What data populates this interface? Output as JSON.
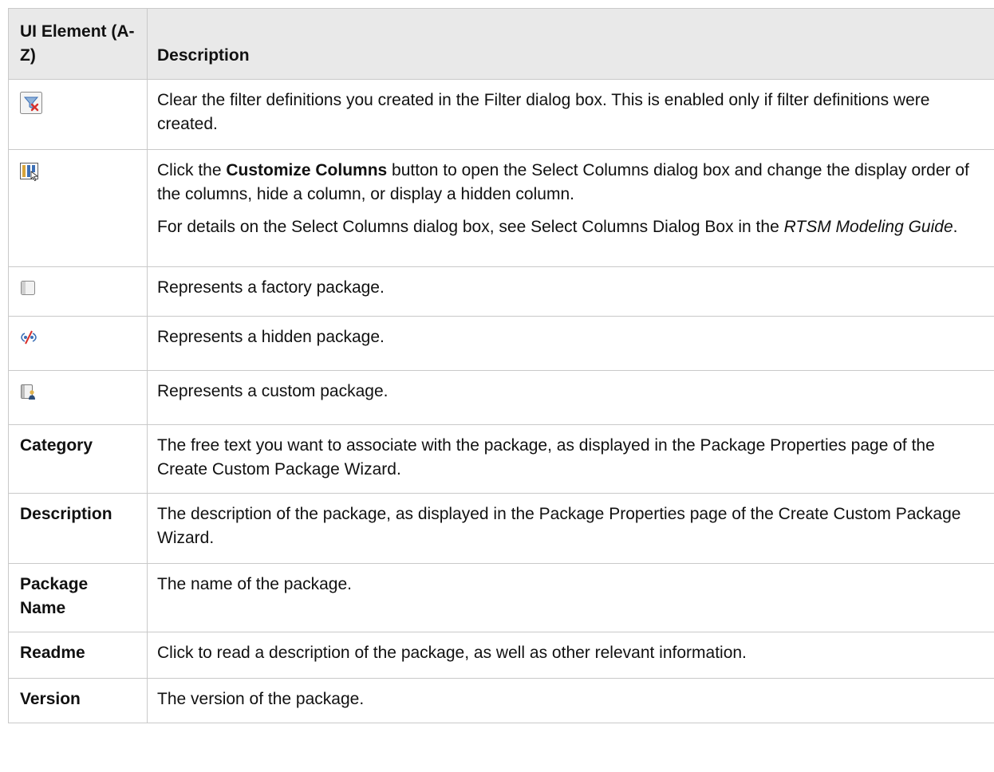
{
  "header": {
    "col1": "UI Element (A-Z)",
    "col2": "Description"
  },
  "rows": [
    {
      "icon": "clear-filter-icon",
      "desc": "Clear the filter definitions you created in the Filter dialog box. This is enabled only if filter definitions were created."
    },
    {
      "icon": "customize-columns-icon",
      "desc_p1_pre": "Click the ",
      "desc_p1_bold": "Customize Columns",
      "desc_p1_post": " button to open the Select Columns dialog box and change the display order of the columns, hide a column, or display a hidden column.",
      "desc_p2_pre": "For details on the Select Columns dialog box, see Select Columns Dialog Box in the ",
      "desc_p2_italic": "RTSM Modeling Guide",
      "desc_p2_post": "."
    },
    {
      "icon": "factory-package-icon",
      "desc": "Represents a factory package."
    },
    {
      "icon": "hidden-package-icon",
      "desc": "Represents a hidden package."
    },
    {
      "icon": "custom-package-icon",
      "desc": "Represents a custom package."
    },
    {
      "element": "Category",
      "desc": "The free text you want to associate with the package, as displayed in the Package Properties page of the Create Custom Package Wizard."
    },
    {
      "element": "Description",
      "desc": "The description of the package, as displayed in the Package Properties page of the Create Custom Package Wizard."
    },
    {
      "element": "Package Name",
      "desc": "The name of the package."
    },
    {
      "element": "Readme",
      "desc": "Click to read a description of the package, as well as other relevant information."
    },
    {
      "element": "Version",
      "desc": "The version of the package."
    }
  ],
  "colors": {
    "header_bg": "#e9e9e9",
    "border": "#c9c9c9",
    "filter_red": "#d9302b",
    "icon_blue": "#3c6fb6"
  }
}
